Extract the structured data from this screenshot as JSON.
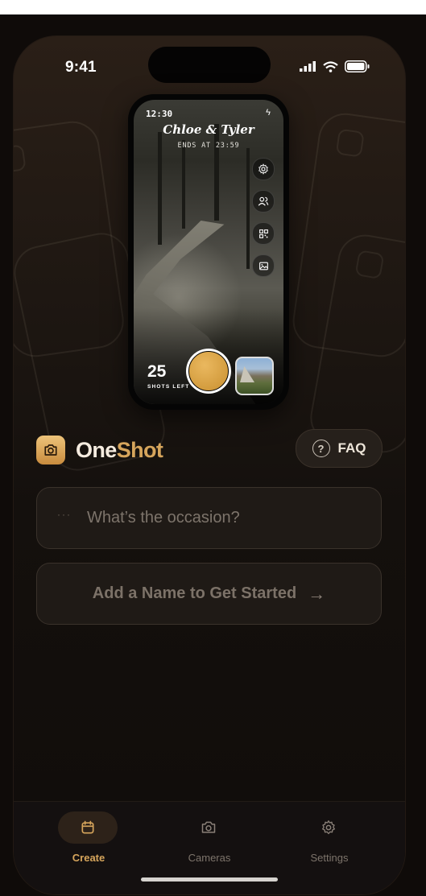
{
  "status_bar": {
    "time": "9:41",
    "icons": [
      "signal-icon",
      "wifi-icon",
      "battery-icon"
    ]
  },
  "preview": {
    "clock": "12:30",
    "event_title": "Chloe & Tyler",
    "ends_text": "ENDS AT 23:59",
    "side_buttons": [
      "settings-icon",
      "guests-icon",
      "qr-code-icon",
      "gallery-icon"
    ],
    "shots_count": "25",
    "shots_label": "SHOTS LEFT"
  },
  "brand": {
    "name_part1": "One",
    "name_part2": "Shot",
    "accent": "#d6a55c"
  },
  "faq": {
    "icon_text": "?",
    "label": "FAQ"
  },
  "occasion": {
    "dots": "···",
    "placeholder": "What’s the occasion?",
    "value": ""
  },
  "start_button": {
    "label": "Add a Name to Get Started",
    "arrow": "→"
  },
  "tabs": [
    {
      "label": "Create",
      "icon": "calendar-icon",
      "active": true
    },
    {
      "label": "Cameras",
      "icon": "camera-icon",
      "active": false
    },
    {
      "label": "Settings",
      "icon": "gear-icon",
      "active": false
    }
  ],
  "colors": {
    "background": "#0f0b09",
    "accent": "#d6a55c",
    "muted_text": "#7c7268"
  }
}
